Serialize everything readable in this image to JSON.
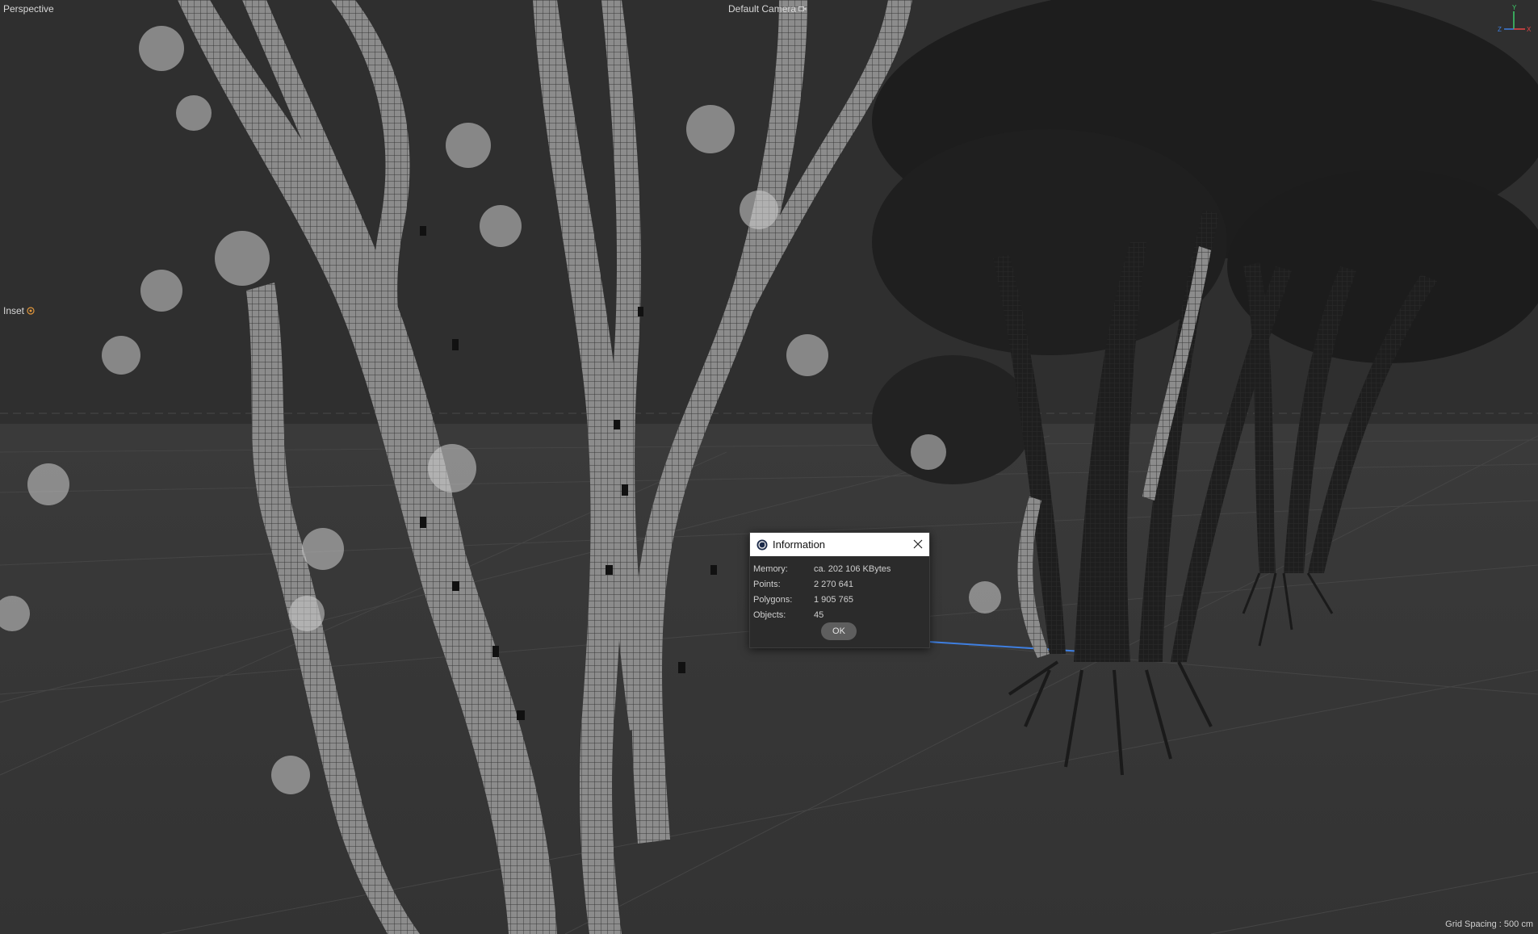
{
  "viewport": {
    "view_label": "Perspective",
    "camera_label": "Default Camera",
    "inset_label": "Inset",
    "grid_spacing": "Grid Spacing : 500 cm",
    "axis_labels": {
      "y": "Y",
      "z": "Z",
      "x": "X"
    }
  },
  "dialog": {
    "title": "Information",
    "rows": [
      {
        "key": "Memory:",
        "value": "ca. 202 106 KBytes"
      },
      {
        "key": "Points:",
        "value": "2 270 641"
      },
      {
        "key": "Polygons:",
        "value": "1 905 765"
      },
      {
        "key": "Objects:",
        "value": "45"
      }
    ],
    "ok_label": "OK"
  },
  "colors": {
    "background": "#2f2f2f",
    "horizon_line": "#6a6a6a",
    "axis_x": "#e64545",
    "axis_y": "#3dcf6a",
    "axis_z": "#3f7fe0",
    "trunk": "#9a9a9a",
    "foliage": "#cfcfcf"
  },
  "icons": {
    "camera": "camera-icon",
    "inset": "render-icon",
    "app": "cinema4d-icon",
    "close": "close-icon"
  }
}
